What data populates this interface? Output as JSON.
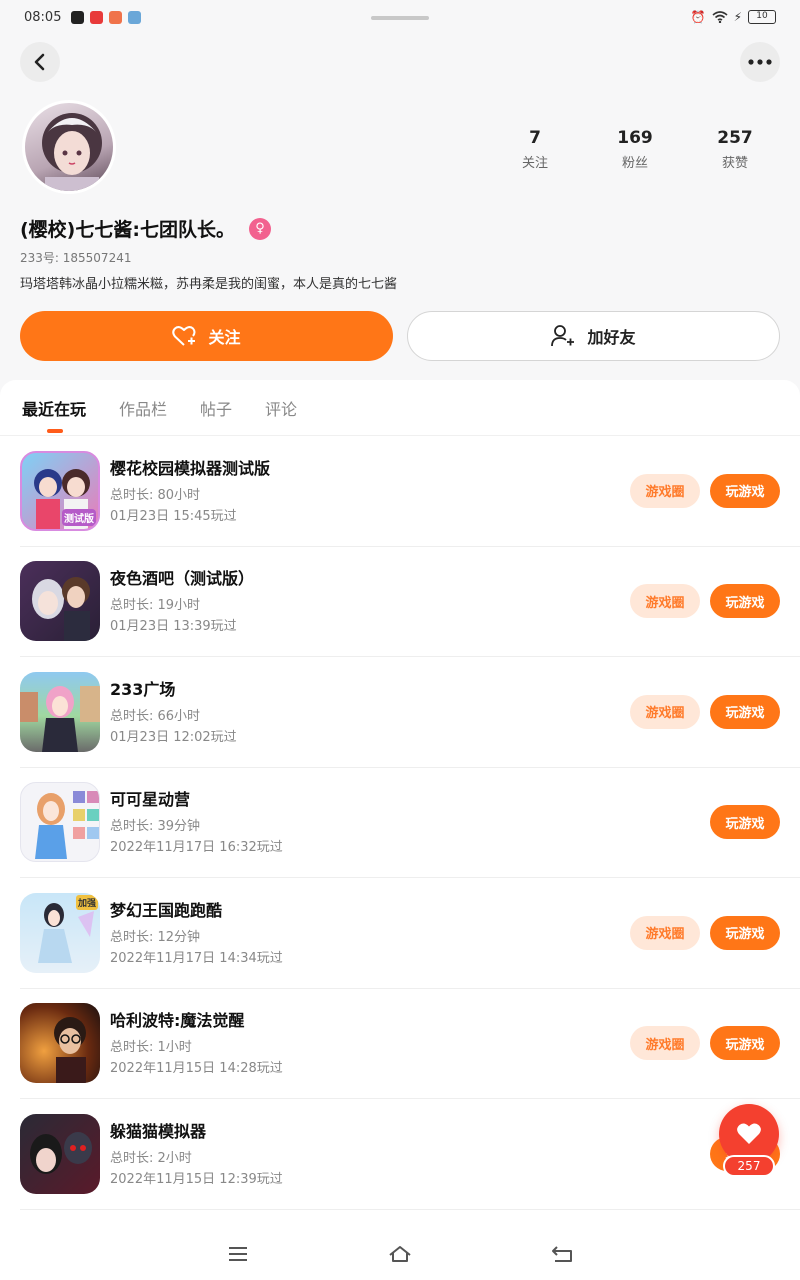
{
  "status_bar": {
    "time": "08:05",
    "battery": "10"
  },
  "profile": {
    "stats": [
      {
        "value": "7",
        "label": "关注"
      },
      {
        "value": "169",
        "label": "粉丝"
      },
      {
        "value": "257",
        "label": "获赞"
      }
    ],
    "nickname": "(樱校)七七酱:七团队长。",
    "gender_symbol": "♀",
    "uid_line": "233号: 185507241",
    "bio": "玛塔塔韩冰晶小拉糯米糍，苏冉柔是我的闺蜜，本人是真的七七酱",
    "follow_label": "关注",
    "add_friend_label": "加好友"
  },
  "tabs": [
    "最近在玩",
    "作品栏",
    "帖子",
    "评论"
  ],
  "games": [
    {
      "name": "樱花校园模拟器测试版",
      "duration": "总时长: 80小时",
      "last_played": "01月23日 15:45玩过",
      "circle": "游戏圈",
      "play": "玩游戏",
      "icon_badge": "测试版"
    },
    {
      "name": "夜色酒吧（测试版）",
      "duration": "总时长: 19小时",
      "last_played": "01月23日 13:39玩过",
      "circle": "游戏圈",
      "play": "玩游戏"
    },
    {
      "name": "233广场",
      "duration": "总时长: 66小时",
      "last_played": "01月23日 12:02玩过",
      "circle": "游戏圈",
      "play": "玩游戏"
    },
    {
      "name": "可可星动营",
      "duration": "总时长: 39分钟",
      "last_played": "2022年11月17日 16:32玩过",
      "play": "玩游戏"
    },
    {
      "name": "梦幻王国跑跑酷",
      "duration": "总时长: 12分钟",
      "last_played": "2022年11月17日 14:34玩过",
      "circle": "游戏圈",
      "play": "玩游戏",
      "icon_badge": "加强"
    },
    {
      "name": "哈利波特:魔法觉醒",
      "duration": "总时长: 1小时",
      "last_played": "2022年11月15日 14:28玩过",
      "circle": "游戏圈",
      "play": "玩游戏"
    },
    {
      "name": "躲猫猫模拟器",
      "duration": "总时长: 2小时",
      "last_played": "2022年11月15日 12:39玩过",
      "play": "玩游戏"
    }
  ],
  "like_fab": {
    "count": "257"
  },
  "colors": {
    "accent": "#ff7617",
    "like": "#f4402f",
    "gender": "#f2628f"
  }
}
